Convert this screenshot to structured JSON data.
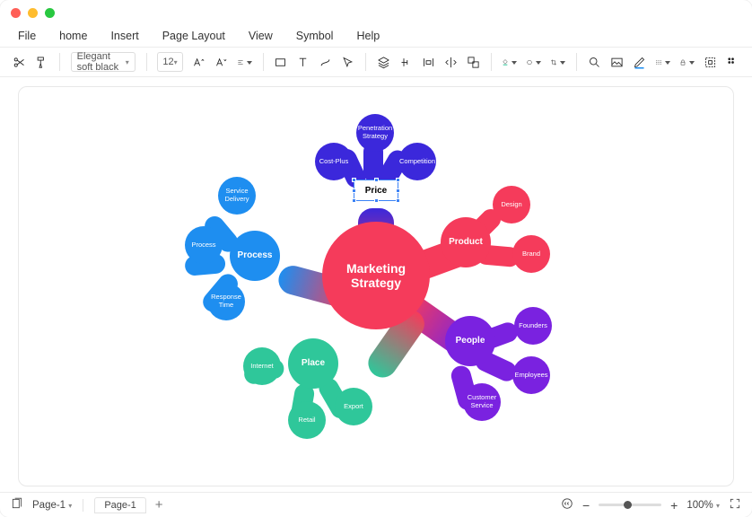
{
  "menu": {
    "file": "File",
    "home": "home",
    "insert": "Insert",
    "pageLayout": "Page Layout",
    "view": "View",
    "symbol": "Symbol",
    "help": "Help"
  },
  "toolbar": {
    "font": "Elegant soft black",
    "size": "12"
  },
  "mindmap": {
    "center": "Marketing Strategy",
    "branches": {
      "price": {
        "label": "Price",
        "color": "#3b28db",
        "leaves": [
          "Penetration Strategy",
          "Cost-Plus",
          "Competition"
        ]
      },
      "product": {
        "label": "Product",
        "color": "#f53b5b",
        "leaves": [
          "Design",
          "Brand"
        ]
      },
      "people": {
        "label": "People",
        "color": "#7a22e0",
        "leaves": [
          "Founders",
          "Employees",
          "Customer Service"
        ]
      },
      "place": {
        "label": "Place",
        "color": "#2fc79a",
        "leaves": [
          "Internet",
          "Retail",
          "Export"
        ]
      },
      "process": {
        "label": "Process",
        "color": "#1e8ef0",
        "leaves": [
          "Service Delivery",
          "Process",
          "Response Time"
        ]
      }
    }
  },
  "status": {
    "pageDropdown": "Page-1",
    "pageTab": "Page-1",
    "zoom": "100%"
  },
  "colors": {
    "center": "#f53b5b"
  }
}
